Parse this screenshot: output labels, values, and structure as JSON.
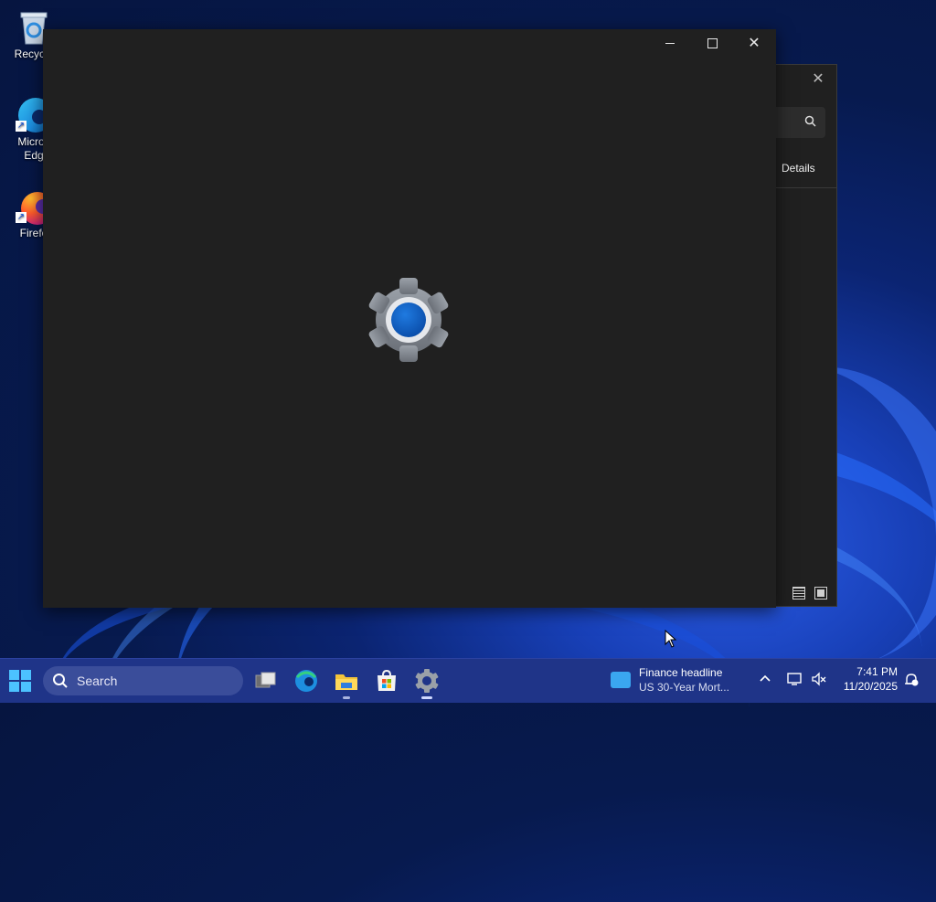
{
  "desktop": {
    "icons": [
      {
        "label_line1": "Recycle",
        "label_line2": ""
      },
      {
        "label_line1": "Micros",
        "label_line2": "Edg"
      },
      {
        "label_line1": "Firefo",
        "label_line2": ""
      }
    ]
  },
  "background_window": {
    "close_glyph": "✕",
    "search_icon_glyph": "🔍",
    "details_label": "Details"
  },
  "main_window": {
    "minimize_glyph": "",
    "maximize_glyph": "",
    "close_glyph": "✕"
  },
  "taskbar": {
    "search_text": "Search",
    "widget": {
      "headline": "Finance headline",
      "subtext": "US 30-Year Mort..."
    },
    "tray": {
      "chevron_glyph": "^",
      "time": "7:41 PM",
      "date": "11/20/2025"
    }
  },
  "colors": {
    "accent": "#4cc2ff",
    "window_bg": "#202020",
    "taskbar_bg": "#1f3488"
  }
}
